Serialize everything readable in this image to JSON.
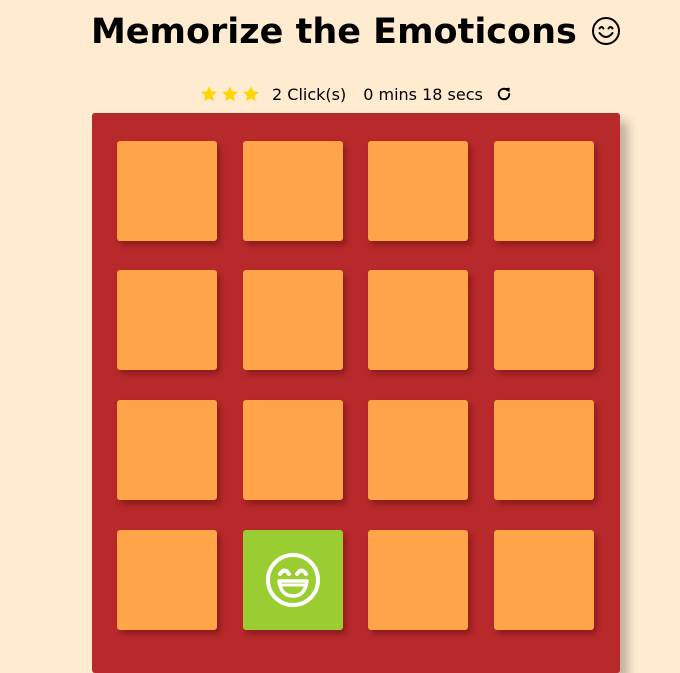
{
  "title": {
    "text": "Memorize the Emoticons",
    "emoticon": "smiling-face-icon"
  },
  "score": {
    "stars": 3,
    "star_color": "#ffd600",
    "moves_text": "2 Click(s)",
    "timer_text": "0 mins 18 secs",
    "restart_icon": "restart-icon"
  },
  "colors": {
    "background": "#ffebd0",
    "deck": "#b8292b",
    "card_closed": "#ffa448",
    "card_open": "#9acd32"
  },
  "cards": [
    {
      "state": "closed"
    },
    {
      "state": "closed"
    },
    {
      "state": "closed"
    },
    {
      "state": "closed"
    },
    {
      "state": "closed"
    },
    {
      "state": "closed"
    },
    {
      "state": "closed"
    },
    {
      "state": "closed"
    },
    {
      "state": "closed"
    },
    {
      "state": "closed"
    },
    {
      "state": "closed"
    },
    {
      "state": "closed"
    },
    {
      "state": "closed"
    },
    {
      "state": "open",
      "icon": "grinning-face-icon"
    },
    {
      "state": "closed"
    },
    {
      "state": "closed"
    }
  ]
}
